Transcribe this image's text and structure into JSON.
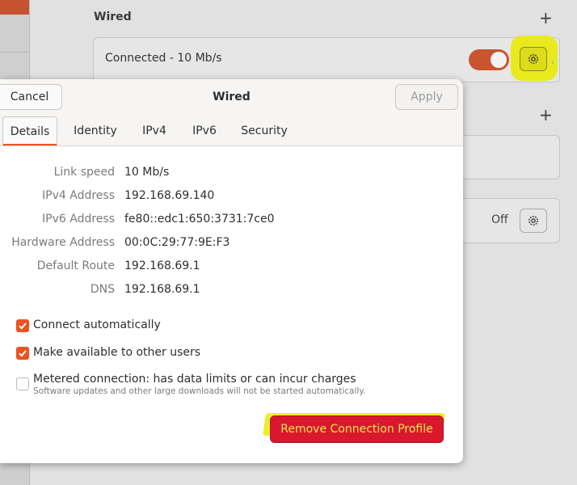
{
  "background": {
    "section_title": "Wired",
    "connection_label": "Connected - 10 Mb/s",
    "toggle_on": true,
    "second_card_status": "Off",
    "accent_color": "#e95420"
  },
  "dialog": {
    "title": "Wired",
    "cancel_label": "Cancel",
    "apply_label": "Apply",
    "tabs": [
      {
        "label": "Details",
        "active": true
      },
      {
        "label": "Identity",
        "active": false
      },
      {
        "label": "IPv4",
        "active": false
      },
      {
        "label": "IPv6",
        "active": false
      },
      {
        "label": "Security",
        "active": false
      }
    ],
    "details": [
      {
        "label": "Link speed",
        "value": "10 Mb/s"
      },
      {
        "label": "IPv4 Address",
        "value": "192.168.69.140"
      },
      {
        "label": "IPv6 Address",
        "value": "fe80::edc1:650:3731:7ce0"
      },
      {
        "label": "Hardware Address",
        "value": "00:0C:29:77:9E:F3"
      },
      {
        "label": "Default Route",
        "value": "192.168.69.1"
      },
      {
        "label": "DNS",
        "value": "192.168.69.1"
      }
    ],
    "checkboxes": [
      {
        "label": "Connect automatically",
        "checked": true
      },
      {
        "label": "Make available to other users",
        "checked": true
      },
      {
        "label": "Metered connection: has data limits or can incur charges",
        "sublabel": "Software updates and other large downloads will not be started automatically.",
        "checked": false
      }
    ],
    "remove_label": "Remove Connection Profile",
    "remove_color": "#d9182f",
    "highlight_color": "#e9ea1e"
  }
}
